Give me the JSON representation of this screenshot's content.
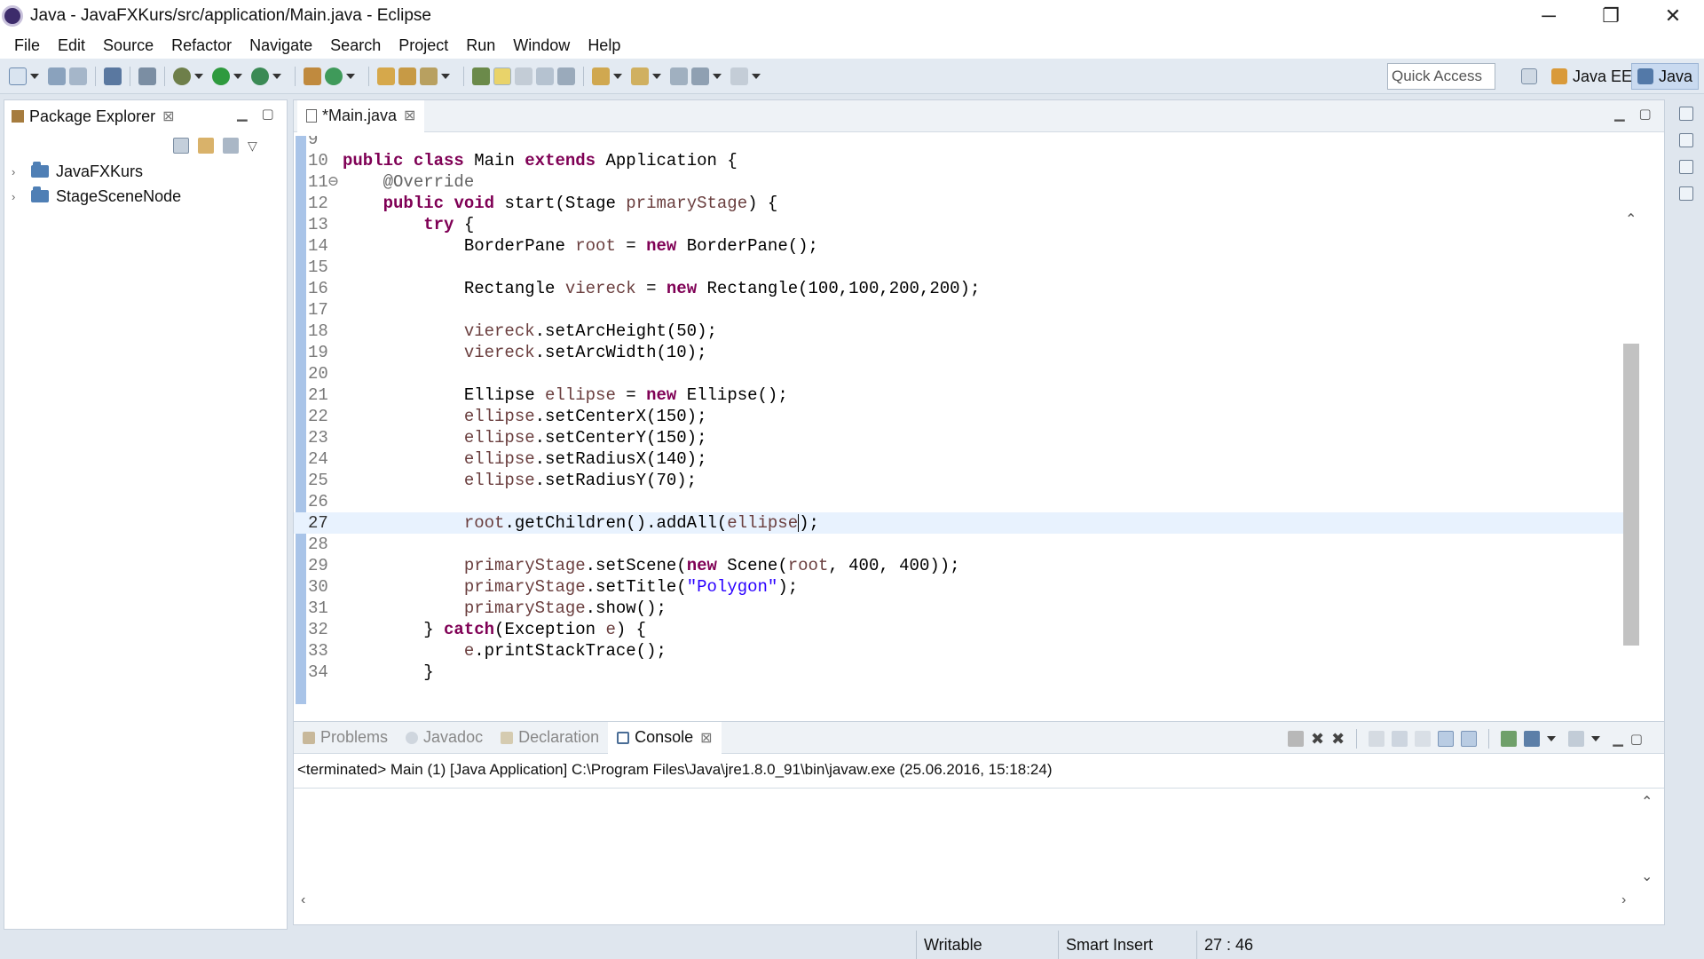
{
  "window": {
    "title": "Java - JavaFXKurs/src/application/Main.java - Eclipse",
    "controls": {
      "minimize": "─",
      "restore": "❐",
      "close": "✕"
    }
  },
  "menu": [
    "File",
    "Edit",
    "Source",
    "Refactor",
    "Navigate",
    "Search",
    "Project",
    "Run",
    "Window",
    "Help"
  ],
  "toolbar": {
    "quick_access_placeholder": "Quick Access",
    "perspectives": [
      {
        "label": "Java EE",
        "icon": "java-ee-perspective-icon",
        "active": false
      },
      {
        "label": "Java",
        "icon": "java-perspective-icon",
        "active": true
      }
    ]
  },
  "package_explorer": {
    "tab_label": "Package Explorer",
    "projects": [
      {
        "name": "JavaFXKurs",
        "icon": "project-folder-icon"
      },
      {
        "name": "StageSceneNode",
        "icon": "project-folder-icon"
      }
    ]
  },
  "editor": {
    "tab_label": "*Main.java",
    "current_line": 27,
    "lines": [
      {
        "n": "9",
        "code": ""
      },
      {
        "n": "10",
        "code": "public class Main extends Application {"
      },
      {
        "n": "11⊖",
        "code": "    @Override"
      },
      {
        "n": "12",
        "code": "    public void start(Stage primaryStage) {"
      },
      {
        "n": "13",
        "code": "        try {"
      },
      {
        "n": "14",
        "code": "            BorderPane root = new BorderPane();"
      },
      {
        "n": "15",
        "code": ""
      },
      {
        "n": "16",
        "code": "            Rectangle viereck = new Rectangle(100,100,200,200);"
      },
      {
        "n": "17",
        "code": ""
      },
      {
        "n": "18",
        "code": "            viereck.setArcHeight(50);"
      },
      {
        "n": "19",
        "code": "            viereck.setArcWidth(10);"
      },
      {
        "n": "20",
        "code": ""
      },
      {
        "n": "21",
        "code": "            Ellipse ellipse = new Ellipse();"
      },
      {
        "n": "22",
        "code": "            ellipse.setCenterX(150);"
      },
      {
        "n": "23",
        "code": "            ellipse.setCenterY(150);"
      },
      {
        "n": "24",
        "code": "            ellipse.setRadiusX(140);"
      },
      {
        "n": "25",
        "code": "            ellipse.setRadiusY(70);"
      },
      {
        "n": "26",
        "code": ""
      },
      {
        "n": "27",
        "code": "            root.getChildren().addAll(ellipse);"
      },
      {
        "n": "28",
        "code": ""
      },
      {
        "n": "29",
        "code": "            primaryStage.setScene(new Scene(root, 400, 400));"
      },
      {
        "n": "30",
        "code": "            primaryStage.setTitle(\"Polygon\");"
      },
      {
        "n": "31",
        "code": "            primaryStage.show();"
      },
      {
        "n": "32",
        "code": "        } catch(Exception e) {"
      },
      {
        "n": "33",
        "code": "            e.printStackTrace();"
      },
      {
        "n": "34",
        "code": "        }"
      }
    ]
  },
  "bottom_panel": {
    "tabs": [
      {
        "label": "Problems",
        "active": false
      },
      {
        "label": "Javadoc",
        "active": false
      },
      {
        "label": "Declaration",
        "active": false
      },
      {
        "label": "Console",
        "active": true
      }
    ],
    "console_header": "<terminated> Main (1) [Java Application] C:\\Program Files\\Java\\jre1.8.0_91\\bin\\javaw.exe (25.06.2016, 15:18:24)"
  },
  "status": {
    "mode": "Writable",
    "insert": "Smart Insert",
    "position": "27 : 46"
  },
  "colors": {
    "keyword": "#7f0055",
    "variable": "#6a3e3e",
    "annotation": "#646464",
    "string": "#2a00ff",
    "toolbar_bg": "#e3eaf2",
    "current_line_bg": "#e8f2fe"
  }
}
